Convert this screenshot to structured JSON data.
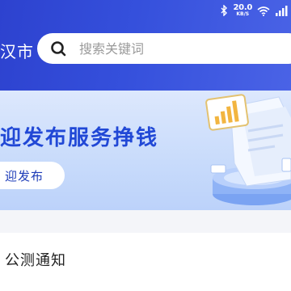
{
  "status_bar": {
    "net_speed_value": "20.0",
    "net_speed_unit": "KB/S"
  },
  "header": {
    "city_label": "汉市",
    "search_placeholder": "搜索关键词",
    "bg_color": "#3550dc"
  },
  "banner": {
    "title": "迎发布服务挣钱",
    "button_label": "迎发布",
    "title_color": "#2148d6"
  },
  "notice": {
    "title": "公测通知"
  },
  "icons": [
    "bluetooth-icon",
    "wifi-icon",
    "signal-icon",
    "search-icon"
  ]
}
